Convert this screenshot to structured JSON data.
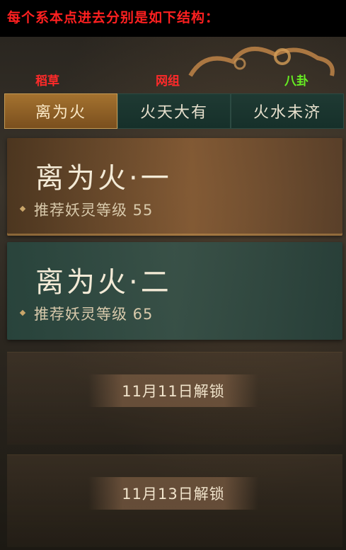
{
  "header": {
    "text": "每个系本点进去分别是如下结构："
  },
  "branches": [
    {
      "label": "稻草",
      "color": "#ff2a2a"
    },
    {
      "label": "网组",
      "color": "#ff2a2a"
    },
    {
      "label": "八卦",
      "color": "#66ee22"
    }
  ],
  "tabs": [
    {
      "label": "离为火",
      "active": true
    },
    {
      "label": "火天大有",
      "active": false
    },
    {
      "label": "火水未济",
      "active": false
    }
  ],
  "stages": [
    {
      "title": "离为火·一",
      "recommend": "推荐妖灵等级 55"
    },
    {
      "title": "离为火·二",
      "recommend": "推荐妖灵等级 65"
    }
  ],
  "locked": [
    {
      "text": "11月11日解锁"
    },
    {
      "text": "11月13日解锁"
    }
  ],
  "colors": {
    "accent_gold": "#a4722f",
    "tab_green": "#1f3a33",
    "header_red": "#ff2020"
  }
}
